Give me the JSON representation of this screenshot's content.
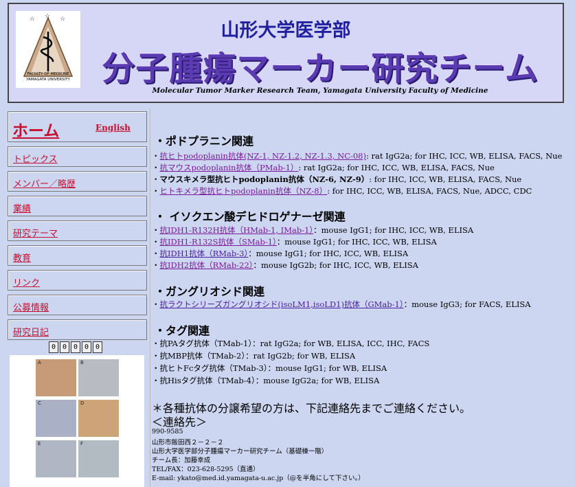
{
  "header": {
    "university": "山形大学医学部",
    "team": "分子腫瘍マーカー研究チーム",
    "english": "Molecular Tumor Marker Research Team, Yamagata University Faculty of Medicine",
    "logo_text_1": "FACULTY OF MEDICINE",
    "logo_text_2": "YAMAGATA UNIVERSITY"
  },
  "sidebar": {
    "home": "ホーム",
    "english": "English",
    "items": [
      {
        "label": "トピックス"
      },
      {
        "label": "メンバー／略歴"
      },
      {
        "label": "業績"
      },
      {
        "label": "研究テーマ"
      },
      {
        "label": "教育"
      },
      {
        "label": "リンク"
      },
      {
        "label": "公募情報"
      },
      {
        "label": "研究日記"
      }
    ],
    "counter": [
      "0",
      "0",
      "0",
      "0",
      "0"
    ],
    "panels": [
      "A",
      "B",
      "C",
      "D",
      "E",
      "F"
    ]
  },
  "main": {
    "sections": [
      {
        "title": "・ポドプラニン関連"
      },
      {
        "title": "・ イソクエン酸デヒドロゲナーゼ関連"
      },
      {
        "title": "・ガングリオシド関連"
      },
      {
        "title": "・タグ関連"
      }
    ],
    "podo": [
      {
        "prefix": "・",
        "link": "抗ヒトpodoplanin抗体(NZ-1, NZ-1.2, NZ-1.3, NC-08)",
        "rest": ": rat IgG2a; for IHC, ICC, WB, ELISA, FACS, Nue"
      },
      {
        "prefix": "・",
        "link": "抗マウスpodoplanin抗体（PMab-1）",
        "rest": ": rat IgG2a; for IHC, ICC, WB, ELISA, FACS, Nue"
      },
      {
        "prefix": "・",
        "link": "マウスキメラ型抗ヒトpodoplanin抗体（NZ-6, NZ-9）",
        "rest": ": for IHC, ICC, WB, ELISA, FACS, Nue"
      },
      {
        "prefix": "・",
        "link": "ヒトキメラ型抗ヒトpodoplanin抗体（NZ-8）",
        "rest": ": for IHC, ICC, WB, ELISA, FACS, Nue, ADCC, CDC"
      }
    ],
    "idh": [
      {
        "prefix": "・",
        "link": "抗IDH1-R132H抗体（HMab-1, IMab-1）",
        "rest": "：mouse IgG1; for IHC, ICC, WB, ELISA"
      },
      {
        "prefix": "・",
        "link": "抗IDH1-R132S抗体（SMab-1）",
        "rest": "：mouse IgG1; for IHC, ICC, WB, ELISA"
      },
      {
        "prefix": "・",
        "link": "抗IDH1抗体（RMab-3）",
        "rest": "：mouse IgG1; for IHC, ICC, WB, ELISA"
      },
      {
        "prefix": "・",
        "link": "抗IDH2抗体（RMab-22）",
        "rest": "：mouse IgG2b; for IHC, ICC, WB, ELISA"
      }
    ],
    "gang": [
      {
        "prefix": "・",
        "link": "抗ラクトシリーズガングリオシド(isoLM1,isoLD1)抗体（GMab-1）",
        "rest": "：mouse IgG3; for FACS, ELISA"
      }
    ],
    "tag": [
      {
        "text": "・抗PAタグ抗体（TMab-1）：rat IgG2a; for WB, ELISA, ICC, IHC, FACS"
      },
      {
        "text": "・抗MBP抗体（TMab-2）：rat IgG2b; for WB, ELISA"
      },
      {
        "text": "・抗ヒトFcタグ抗体（TMab-3）：mouse IgG1; for WB, ELISA"
      },
      {
        "text": "・抗Hisタグ抗体（TMab-4）：mouse IgG2a; for WB, ELISA"
      }
    ],
    "notice": "＊各種抗体の分譲希望の方は、下記連絡先までご連絡ください。",
    "contact_title": "＜連絡先＞",
    "contact": [
      "990-9585",
      "山形市飯田西２－２－２",
      "山形大学医学部分子腫瘍マーカー研究チーム（基礎棟一階）",
      "チーム長：加藤幸成",
      "TEL/FAX：023-628-5295（直通）",
      "E-mail: ykato@med.id.yamagata-u.ac.jp（@を半角にして下さい。）"
    ]
  }
}
